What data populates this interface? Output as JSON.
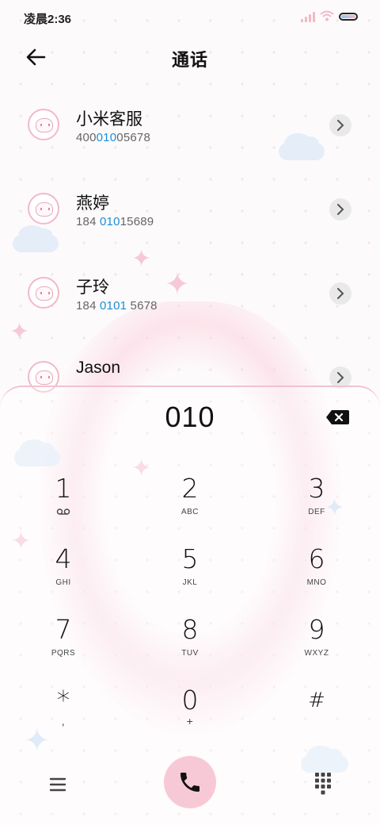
{
  "status_bar": {
    "time": "凌晨2:36",
    "icons": [
      "signal-icon",
      "wifi-icon",
      "battery-icon"
    ]
  },
  "header": {
    "title": "通话",
    "back_icon": "arrow-left-icon"
  },
  "contacts": [
    {
      "name": "小米客服",
      "number_parts": [
        "400",
        "010",
        "05678"
      ]
    },
    {
      "name": "燕婷",
      "number_parts": [
        "184 ",
        "010",
        "15689"
      ]
    },
    {
      "name": "子玲",
      "number_parts": [
        "184 ",
        "0101",
        " 5678"
      ]
    },
    {
      "name": "Jason",
      "number_parts": [
        "",
        "",
        ""
      ]
    }
  ],
  "dialer": {
    "input": "010",
    "highlight_color": "#1a8fd6",
    "keys": [
      {
        "digit": "1",
        "sub": "",
        "sub_icon": "voicemail-icon"
      },
      {
        "digit": "2",
        "sub": "ABC"
      },
      {
        "digit": "3",
        "sub": "DEF"
      },
      {
        "digit": "4",
        "sub": "GHI"
      },
      {
        "digit": "5",
        "sub": "JKL"
      },
      {
        "digit": "6",
        "sub": "MNO"
      },
      {
        "digit": "7",
        "sub": "PQRS"
      },
      {
        "digit": "8",
        "sub": "TUV"
      },
      {
        "digit": "9",
        "sub": "WXYZ"
      },
      {
        "digit": "*",
        "sub": ","
      },
      {
        "digit": "0",
        "sub": "+"
      },
      {
        "digit": "#",
        "sub": ""
      }
    ]
  },
  "bottom_bar": {
    "menu_icon": "menu-icon",
    "call_icon": "phone-icon",
    "call_button_color": "#f7c9d6",
    "keypad_icon": "dialpad-icon"
  }
}
